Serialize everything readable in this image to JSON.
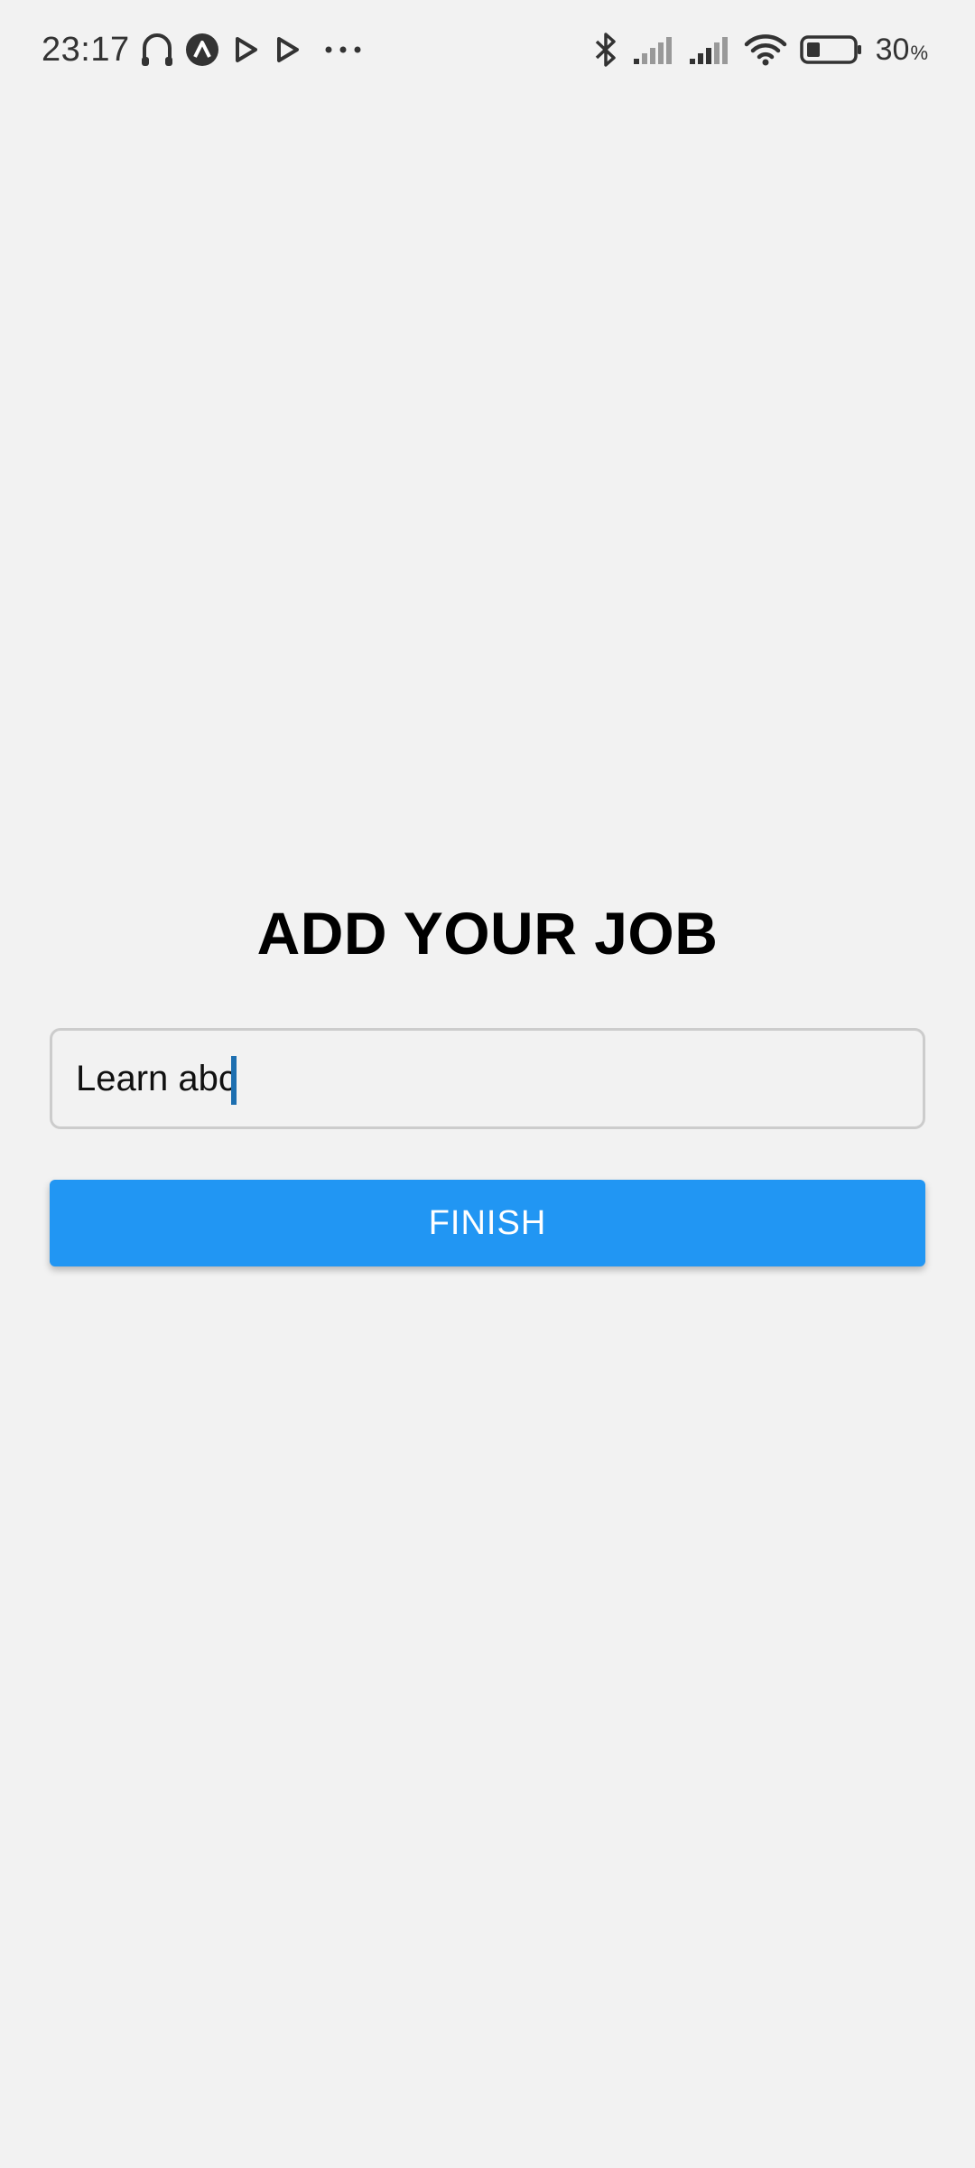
{
  "status_bar": {
    "time": "23:17",
    "left_icons": [
      "headset-icon",
      "app-a-icon",
      "play-icon",
      "play-icon",
      "more-dots-icon"
    ],
    "right_icons": [
      "bluetooth-icon",
      "signal-icon",
      "signal-icon",
      "wifi-icon",
      "battery-icon"
    ],
    "battery_level": "30",
    "battery_unit": "%"
  },
  "main": {
    "title": "ADD YOUR JOB",
    "job_input": {
      "value": "Learn abc"
    },
    "finish_label": "FINISH"
  },
  "colors": {
    "background": "#f2f2f2",
    "button": "#2196f3",
    "button_text": "#ffffff",
    "caret": "#1d6fb0"
  }
}
